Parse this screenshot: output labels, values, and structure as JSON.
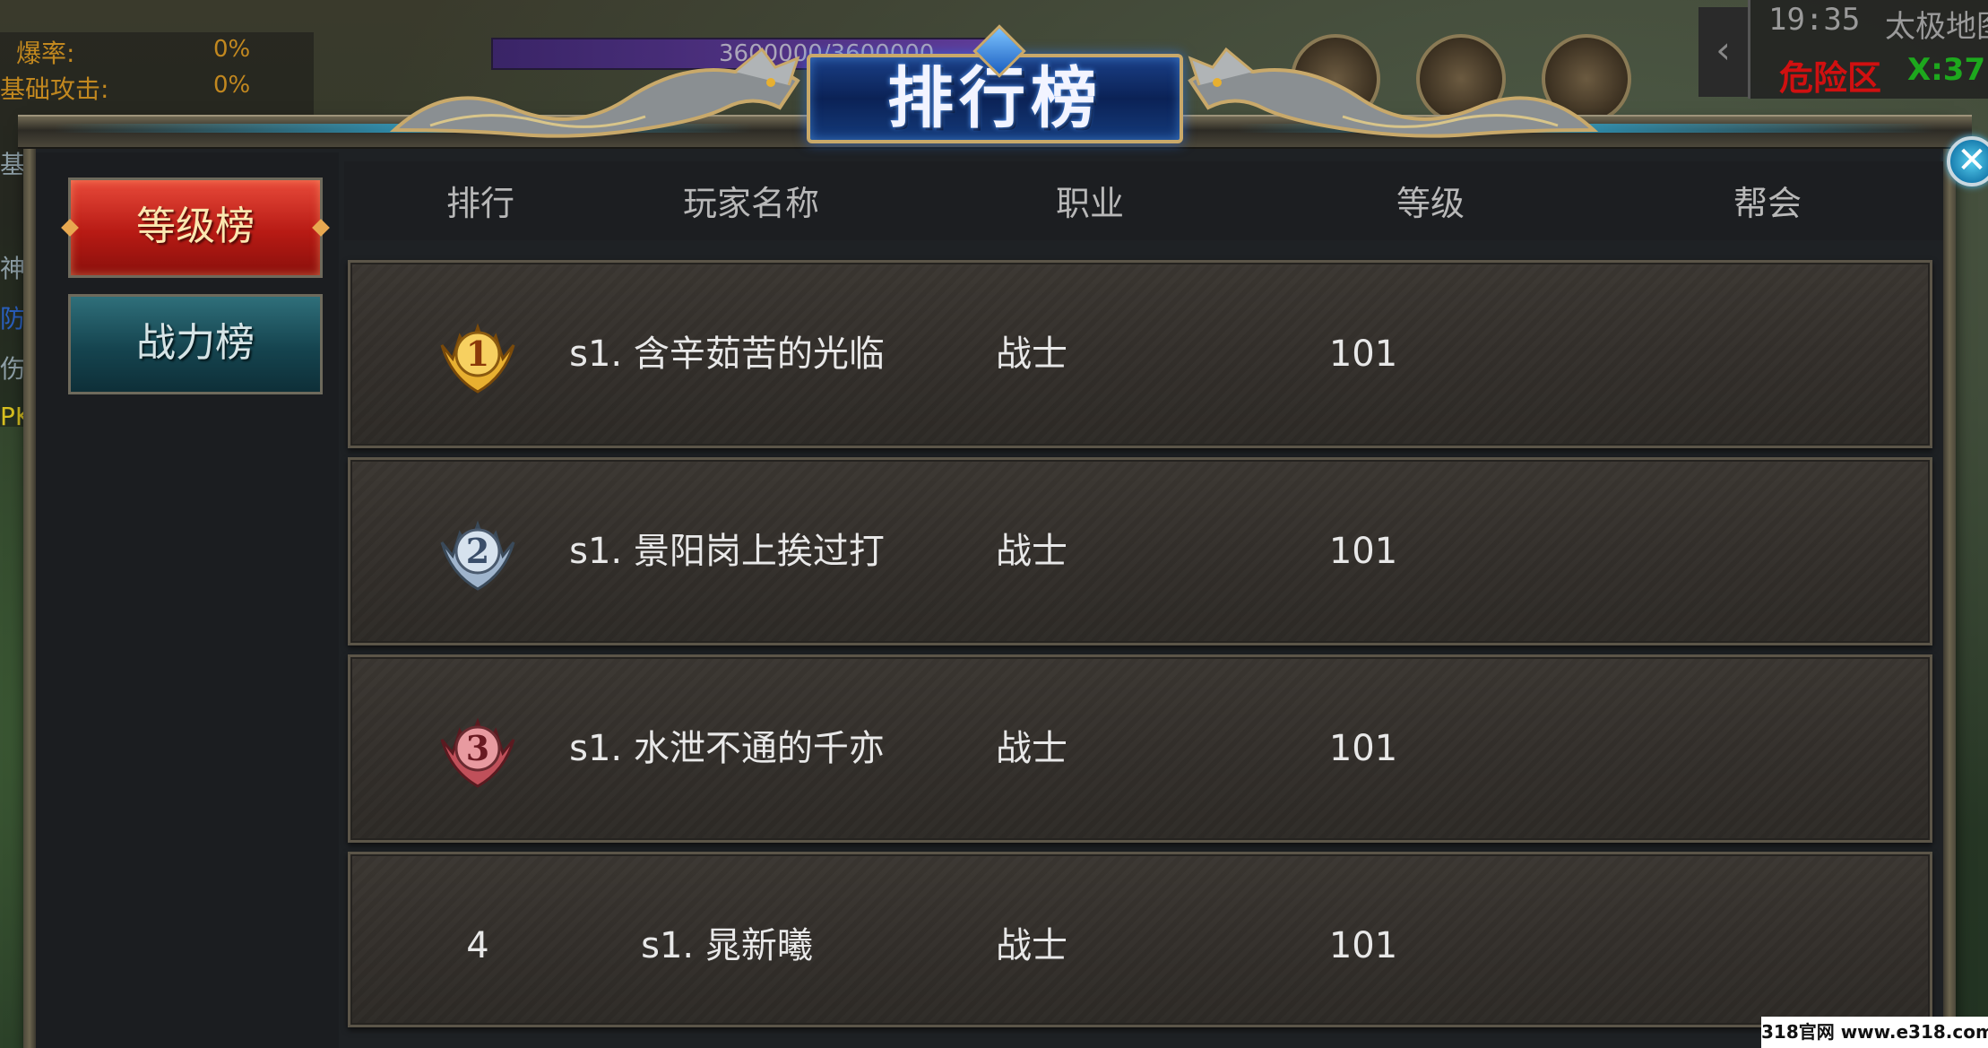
{
  "hud": {
    "stat1_label": "爆率:",
    "stat1_value": "0%",
    "stat2_label": "基础攻击:",
    "stat2_value": "0%",
    "side_texts": [
      "基",
      "神圣",
      "防御",
      "伤害",
      "PK"
    ],
    "hp_text": "3600000/3600000",
    "time": "19:35",
    "map_name": "太极地图",
    "zone_warning": "危险区",
    "coord": "X:37"
  },
  "panel": {
    "title": "排行榜",
    "close_label": "✕"
  },
  "tabs": [
    {
      "label": "等级榜",
      "active": true
    },
    {
      "label": "战力榜",
      "active": false
    }
  ],
  "columns": [
    "排行",
    "玩家名称",
    "职业",
    "等级",
    "帮会"
  ],
  "rows": [
    {
      "rank": "1",
      "medal": "gold-medal-icon",
      "name": "s1. 含辛茹苦的光临",
      "job": "战士",
      "level": "101",
      "guild": ""
    },
    {
      "rank": "2",
      "medal": "silver-medal-icon",
      "name": "s1. 景阳岗上挨过打",
      "job": "战士",
      "level": "101",
      "guild": ""
    },
    {
      "rank": "3",
      "medal": "bronze-medal-icon",
      "name": "s1. 水泄不通的千亦",
      "job": "战士",
      "level": "101",
      "guild": ""
    },
    {
      "rank": "4",
      "medal": "",
      "name": "s1. 晁新曦",
      "job": "战士",
      "level": "101",
      "guild": ""
    }
  ],
  "watermark": "318官网 www.e318.com",
  "colors": {
    "active_tab": "#b71a14",
    "inactive_tab": "#15444f",
    "title_plaque": "#0b2256",
    "gold": "#e8b030",
    "silver": "#9fb4cc",
    "bronze": "#c0505a",
    "danger_text": "#d01010",
    "coord_text": "#1da81d"
  }
}
